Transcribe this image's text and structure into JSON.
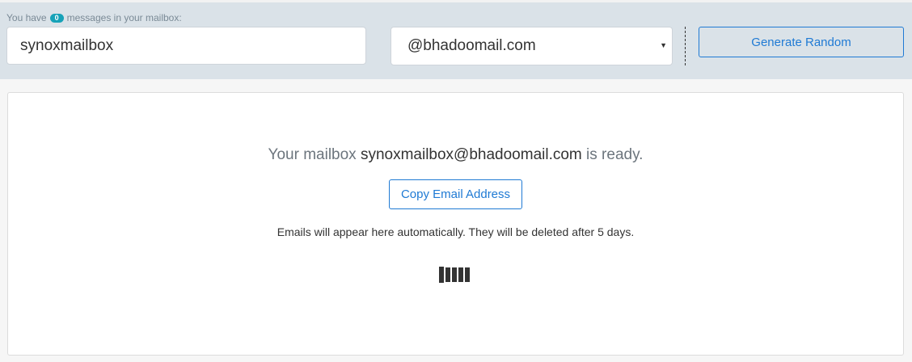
{
  "header": {
    "message_prefix": "You have",
    "message_count": "0",
    "message_suffix": "messages in your mailbox:",
    "username_value": "synoxmailbox",
    "domain_selected": "@bhadoomail.com",
    "generate_button_label": "Generate Random"
  },
  "mailbox": {
    "ready_prefix": "Your mailbox",
    "address": "synoxmailbox@bhadoomail.com",
    "ready_suffix": "is ready.",
    "copy_button_label": "Copy Email Address",
    "info_text": "Emails will appear here automatically. They will be deleted after 5 days."
  },
  "colors": {
    "accent": "#1f7ad4",
    "badge": "#17a2b8",
    "header_bg": "#dae2e8"
  },
  "icons": {
    "select_caret": "chevron-down-icon",
    "loader": "loading-bars-icon"
  }
}
